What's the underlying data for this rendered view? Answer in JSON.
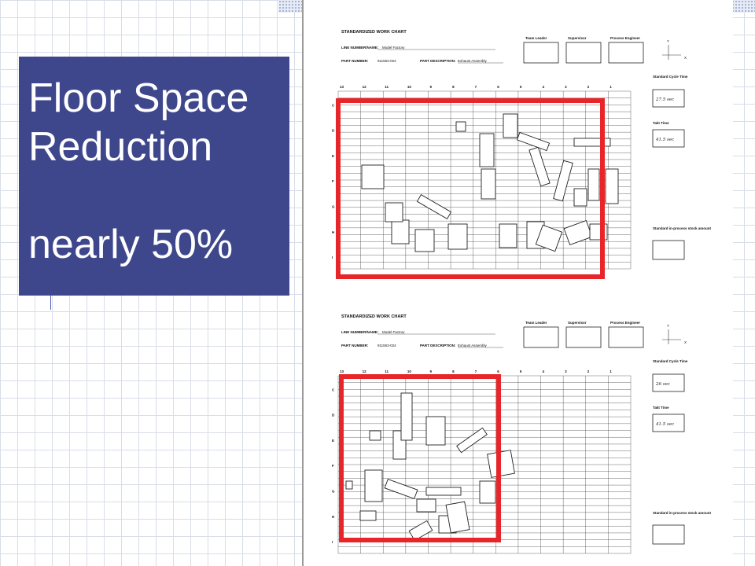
{
  "slide": {
    "title_line1": "Floor Space",
    "title_line2": "Reduction",
    "title_line3": "nearly 50%"
  },
  "colors": {
    "title_box": "#3f478c",
    "title_text": "#ffffff",
    "highlight_frame": "#e8262a"
  },
  "charts": [
    {
      "heading": "STANDARDIZED WORK CHART",
      "line_label": "LINE NUMBER/NAME:",
      "line_value": "Model Factory",
      "part_number_label": "PART NUMBER:",
      "part_number_value": "911553-024",
      "part_desc_label": "PART DESCRIPTION:",
      "part_desc_value": "Exhaust Assembly",
      "signoffs": [
        "Team Leader",
        "Supervisor",
        "Process Engineer"
      ],
      "axis_y": "Y",
      "axis_x": "X",
      "columns": [
        "13",
        "12",
        "11",
        "10",
        "9",
        "8",
        "7",
        "6",
        "5",
        "4",
        "3",
        "2",
        "1"
      ],
      "rows": [
        "C",
        "D",
        "E",
        "F",
        "G",
        "H",
        "I"
      ],
      "standard_cycle_label": "Standard Cycle Time",
      "standard_cycle_value": "27.5 sec",
      "takt_label": "Takt Time",
      "takt_value": "41.5 sec",
      "wip_label": "Standard in-process stock amount"
    },
    {
      "heading": "STANDARDIZED WORK CHART",
      "line_label": "LINE NUMBER/NAME:",
      "line_value": "Model Factory",
      "part_number_label": "PART NUMBER:",
      "part_number_value": "911553-024",
      "part_desc_label": "PART DESCRIPTION:",
      "part_desc_value": "Exhaust Assembly",
      "signoffs": [
        "Team Leader",
        "Supervisor",
        "Process Engineer"
      ],
      "axis_y": "Y",
      "axis_x": "X",
      "columns": [
        "13",
        "12",
        "11",
        "10",
        "9",
        "8",
        "7",
        "6",
        "5",
        "4",
        "3",
        "2",
        "1"
      ],
      "rows": [
        "C",
        "D",
        "E",
        "F",
        "G",
        "H",
        "I"
      ],
      "standard_cycle_label": "Standard Cycle Time",
      "standard_cycle_value": "26 sec",
      "takt_label": "Takt Time",
      "takt_value": "41.5 sec",
      "wip_label": "Standard in-process stock amount"
    }
  ]
}
